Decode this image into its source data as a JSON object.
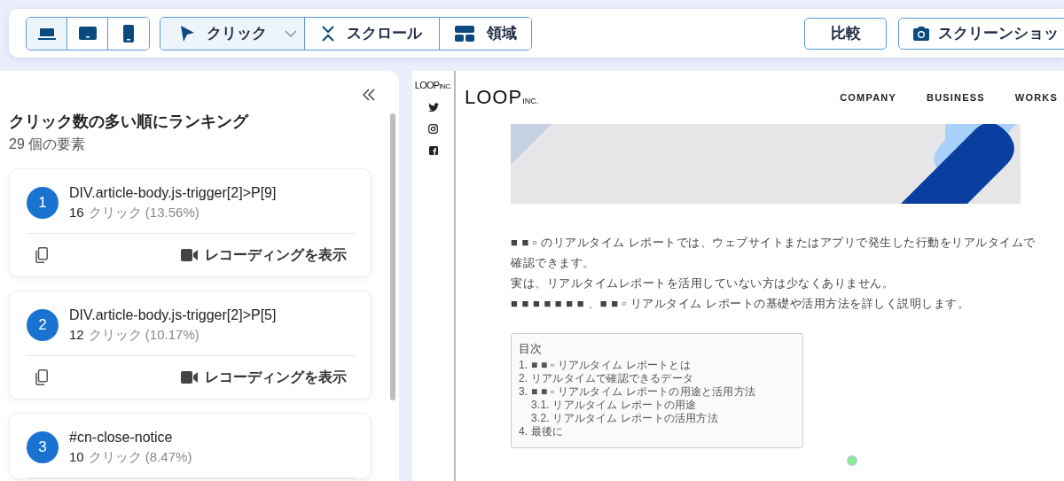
{
  "toolbar": {
    "devices": [
      {
        "kind": "desktop",
        "selected": true
      },
      {
        "kind": "tablet",
        "selected": false
      },
      {
        "kind": "mobile",
        "selected": false
      }
    ],
    "modes": [
      {
        "kind": "click",
        "label": "クリック",
        "selected": true,
        "dropdown": true
      },
      {
        "kind": "scroll",
        "label": "スクロール",
        "selected": false,
        "dropdown": false
      },
      {
        "kind": "area",
        "label": "領域",
        "selected": false,
        "dropdown": false
      }
    ],
    "compare_button": "比較",
    "screenshot_button": "スクリーンショッ"
  },
  "panel": {
    "title": "クリック数の多い順にランキング",
    "count": "29 個の要素",
    "items": [
      {
        "rank": "1",
        "selector": "DIV.article-body.js-trigger[2]>P[9]",
        "clicks": "16",
        "detail": "クリック (13.56%)",
        "action": "レコーディングを表示"
      },
      {
        "rank": "2",
        "selector": "DIV.article-body.js-trigger[2]>P[5]",
        "clicks": "12",
        "detail": "クリック (10.17%)",
        "action": "レコーディングを表示"
      },
      {
        "rank": "3",
        "selector": "#cn-close-notice",
        "clicks": "10",
        "detail": "クリック (8.47%)"
      }
    ]
  },
  "preview": {
    "side_logo": {
      "name": "LOOP",
      "suffix": "INC."
    },
    "logo": {
      "name": "LOOP",
      "suffix": "INC."
    },
    "nav": [
      "COMPANY",
      "BUSINESS",
      "WORKS"
    ],
    "paragraphs": [
      "■ ■ ▫ のリアルタイム レポートでは、ウェブサイトまたはアプリで発生した行動をリアルタイムで確認できます。",
      "実は、リアルタイムレポートを活用していない方は少なくありません。",
      "■ ■ ■ ■ ■ ■ ■ 、■ ■ ▫ リアルタイム レポートの基礎や活用方法を詳しく説明します。"
    ],
    "toc": {
      "title": "目次",
      "items": [
        {
          "label": "1. ■ ■ ▫ リアルタイム レポートとは"
        },
        {
          "label": "2. リアルタイムで確認できるデータ"
        },
        {
          "label": "3. ■ ■ ▫ リアルタイム レポートの用途と活用方法",
          "children": [
            {
              "label": "3.1. リアルタイム レポートの用途"
            },
            {
              "label": "3.2. リアルタイム レポートの活用方法"
            }
          ]
        },
        {
          "label": "4. 最後に"
        }
      ]
    }
  }
}
